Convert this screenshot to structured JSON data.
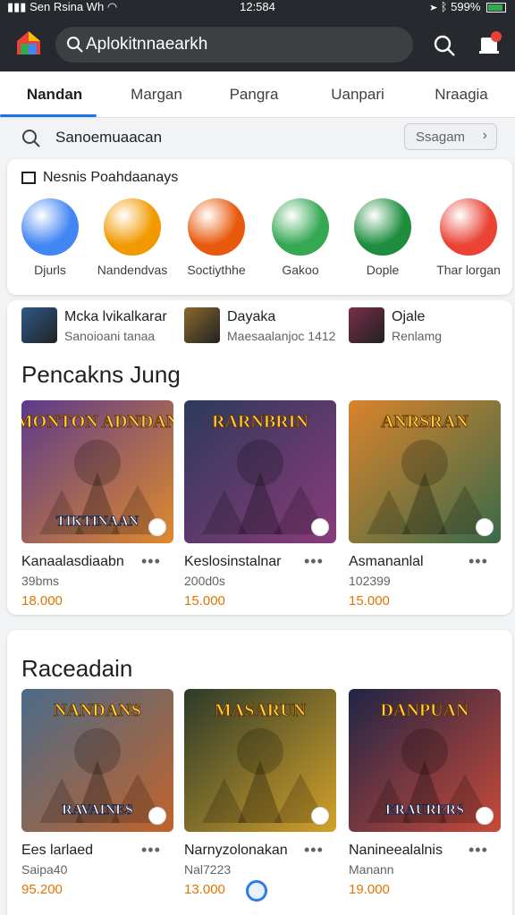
{
  "status": {
    "left": "Sen Rsina Wh",
    "time": "12:584",
    "battery": "599%"
  },
  "search": {
    "text": "Aplokitnnaearkh"
  },
  "tabs": [
    "Nandan",
    "Margan",
    "Pangra",
    "Uanpari",
    "Nraagia"
  ],
  "search_row": {
    "text": "Sanoemuaacan",
    "button": "Ssagam"
  },
  "quick": {
    "title": "Nesnis Poahdaanays",
    "apps": [
      {
        "label": "Djurls",
        "color": "#4285f4"
      },
      {
        "label": "Nandendvas",
        "color": "#f29900"
      },
      {
        "label": "Soctiythhe",
        "color": "#e8590c"
      },
      {
        "label": "Gakoo",
        "color": "#34a853"
      },
      {
        "label": "Dople",
        "color": "#1e8e3e"
      },
      {
        "label": "Thar lorgan",
        "color": "#ea4335"
      }
    ]
  },
  "mini_row": [
    {
      "title": "Mcka lvikalkarar",
      "sub": "Sanoioani tanaa"
    },
    {
      "title": "Dayaka",
      "sub": "Maesaalanjoc 1412"
    },
    {
      "title": "Ojale",
      "sub": "Renlamg"
    }
  ],
  "section1": {
    "title": "Pencakns Jung",
    "games": [
      {
        "art": "MONTON ADNDAN",
        "art2": "TIKTINAAN",
        "title": "Kanaalasdiaabn",
        "sub": "39bms",
        "price": "18.000",
        "c1": "#5b3a8c",
        "c2": "#e08a2c"
      },
      {
        "art": "RARNBRIN",
        "art2": "",
        "title": "Keslosinstalnar",
        "sub": "200d0s",
        "price": "15.000",
        "c1": "#2c3a5a",
        "c2": "#8a3b7a"
      },
      {
        "art": "ANRSRAN",
        "art2": "",
        "title": "Asmananlal",
        "sub": "102399",
        "price": "15.000",
        "c1": "#d9832b",
        "c2": "#3a6a4a"
      }
    ]
  },
  "section2": {
    "title": "Raceadain",
    "games": [
      {
        "art": "NANDANS",
        "art2": "RAVAINES",
        "title": "Ees larlaed",
        "sub": "Saipa40",
        "price": "95.200",
        "c1": "#4a6b8a",
        "c2": "#c2632a"
      },
      {
        "art": "MASARUN",
        "art2": "",
        "title": "Narnyzolonakan",
        "sub": "Nal7223",
        "price": "13.000",
        "c1": "#2a3a2a",
        "c2": "#d4a12a"
      },
      {
        "art": "DANPUAN",
        "art2": "ERAURERS",
        "title": "Nanineealalnis",
        "sub": "Manann",
        "price": "19.000",
        "c1": "#1f2445",
        "c2": "#c84a3a"
      }
    ]
  },
  "colors": {
    "accent": "#1a73e8",
    "topbar": "#26292e",
    "price": "#e37400"
  }
}
